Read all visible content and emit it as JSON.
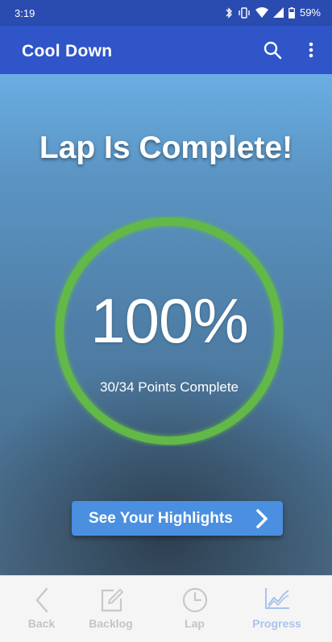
{
  "status_bar": {
    "time": "3:19",
    "battery": "59%"
  },
  "app_bar": {
    "title": "Cool Down",
    "search_icon": "search-icon",
    "more_icon": "more-vert-icon"
  },
  "main": {
    "headline": "Lap Is Complete!",
    "progress": {
      "percent_text": "100%",
      "fraction": 1.0,
      "points_text": "30/34 Points Complete",
      "ring_color": "#63b946"
    },
    "highlights_button": {
      "label": "See Your Highlights",
      "icon": "chevron-right-icon"
    }
  },
  "bottom_nav": {
    "items": [
      {
        "label": "Back",
        "icon": "chevron-left-icon",
        "active": false
      },
      {
        "label": "Backlog",
        "icon": "edit-icon",
        "active": false
      },
      {
        "label": "Lap",
        "icon": "clock-icon",
        "active": false
      },
      {
        "label": "Progress",
        "icon": "chart-line-icon",
        "active": true
      }
    ]
  },
  "colors": {
    "status_bar": "#2a4bb0",
    "app_bar": "#2f55c8",
    "button": "#4a8fe0",
    "active_nav": "#a9c3ea",
    "inactive_nav": "#c4c4c4"
  }
}
